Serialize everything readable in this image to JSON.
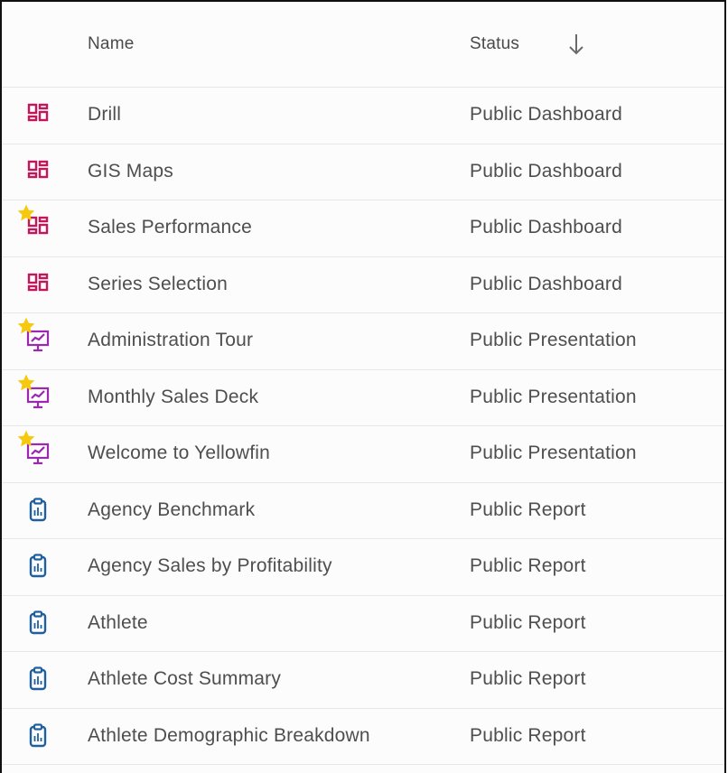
{
  "header": {
    "name_label": "Name",
    "status_label": "Status",
    "sort_icon": "arrow-down-icon"
  },
  "colors": {
    "dashboard": "#c2185b",
    "presentation": "#9c27b0",
    "report": "#1e5f9e",
    "star": "#f6c90e",
    "text": "#4e4e4e"
  },
  "rows": [
    {
      "name": "Drill",
      "status": "Public Dashboard",
      "type": "dashboard",
      "favorite": false
    },
    {
      "name": "GIS Maps",
      "status": "Public Dashboard",
      "type": "dashboard",
      "favorite": false
    },
    {
      "name": "Sales Performance",
      "status": "Public Dashboard",
      "type": "dashboard",
      "favorite": true
    },
    {
      "name": "Series Selection",
      "status": "Public Dashboard",
      "type": "dashboard",
      "favorite": false
    },
    {
      "name": "Administration Tour",
      "status": "Public Presentation",
      "type": "presentation",
      "favorite": true
    },
    {
      "name": "Monthly Sales Deck",
      "status": "Public Presentation",
      "type": "presentation",
      "favorite": true
    },
    {
      "name": "Welcome to Yellowfin",
      "status": "Public Presentation",
      "type": "presentation",
      "favorite": true
    },
    {
      "name": "Agency Benchmark",
      "status": "Public Report",
      "type": "report",
      "favorite": false
    },
    {
      "name": "Agency Sales by Profitability",
      "status": "Public Report",
      "type": "report",
      "favorite": false
    },
    {
      "name": "Athlete",
      "status": "Public Report",
      "type": "report",
      "favorite": false
    },
    {
      "name": "Athlete Cost Summary",
      "status": "Public Report",
      "type": "report",
      "favorite": false
    },
    {
      "name": "Athlete Demographic Breakdown",
      "status": "Public Report",
      "type": "report",
      "favorite": false
    }
  ]
}
